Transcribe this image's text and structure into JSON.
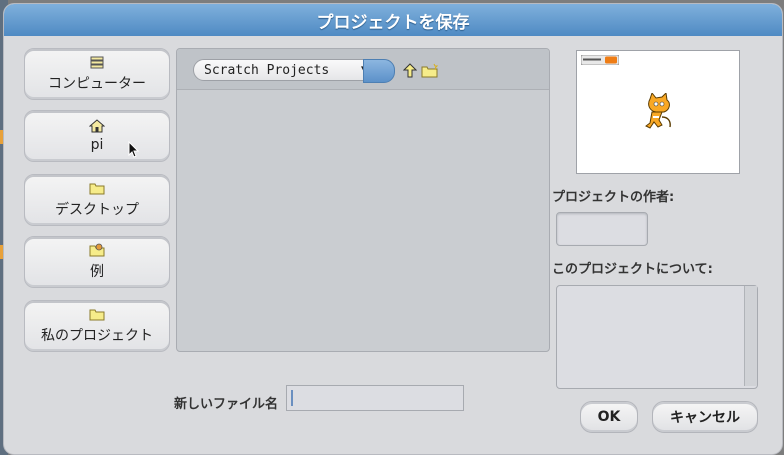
{
  "dialog": {
    "title": "プロジェクトを保存"
  },
  "sidebar": {
    "items": [
      {
        "label": "コンピューター",
        "icon": "disk-stack-icon"
      },
      {
        "label": "pi",
        "icon": "home-icon"
      },
      {
        "label": "デスクトップ",
        "icon": "folder-icon"
      },
      {
        "label": "例",
        "icon": "folder-examples-icon"
      },
      {
        "label": "私のプロジェクト",
        "icon": "folder-icon"
      }
    ]
  },
  "browser": {
    "folder": "Scratch Projects"
  },
  "right_panel": {
    "author_label": "プロジェクトの作者:",
    "author_value": "",
    "about_label": "このプロジェクトについて:",
    "about_value": ""
  },
  "footer": {
    "filename_label": "新しいファイル名",
    "filename_value": "",
    "ok_label": "OK",
    "cancel_label": "キャンセル"
  },
  "colors": {
    "title_bar": "#4f8ac3",
    "dialog_bg": "#d9dadd",
    "accent_blue": "#5c91c9"
  }
}
